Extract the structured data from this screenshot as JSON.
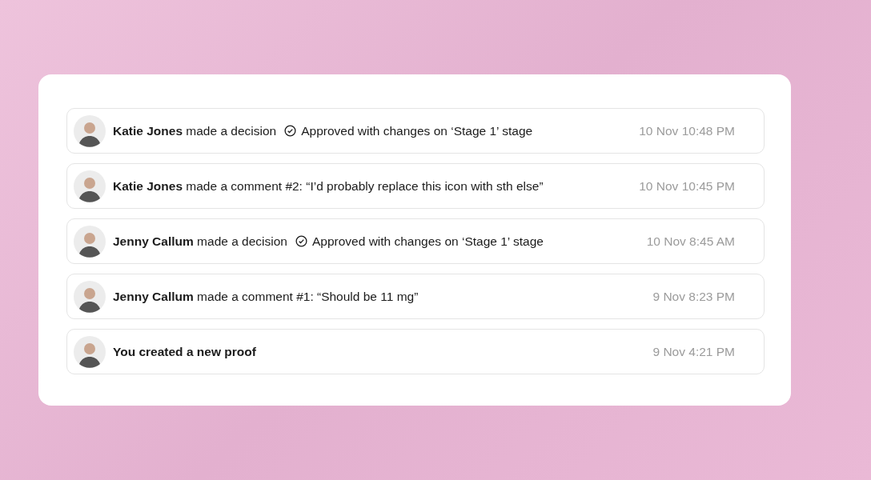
{
  "activity": [
    {
      "kind": "decision",
      "actor": "Katie Jones",
      "action": "made a decision",
      "decision": "Approved with changes on ‘Stage 1’ stage",
      "time": "10 Nov 10:48 PM"
    },
    {
      "kind": "comment",
      "actor": "Katie Jones",
      "action": "made a comment #2: “I’d probably replace this icon with sth else”",
      "time": "10 Nov 10:45 PM"
    },
    {
      "kind": "decision",
      "actor": "Jenny Callum",
      "action": "made a decision",
      "decision": "Approved with changes on ‘Stage 1’ stage",
      "time": "10 Nov 8:45 AM"
    },
    {
      "kind": "comment",
      "actor": "Jenny Callum",
      "action": "made a comment #1: “Should be 11 mg”",
      "time": "9 Nov 8:23 PM"
    },
    {
      "kind": "created",
      "text": "You created a new proof",
      "time": "9 Nov 4:21 PM"
    }
  ]
}
